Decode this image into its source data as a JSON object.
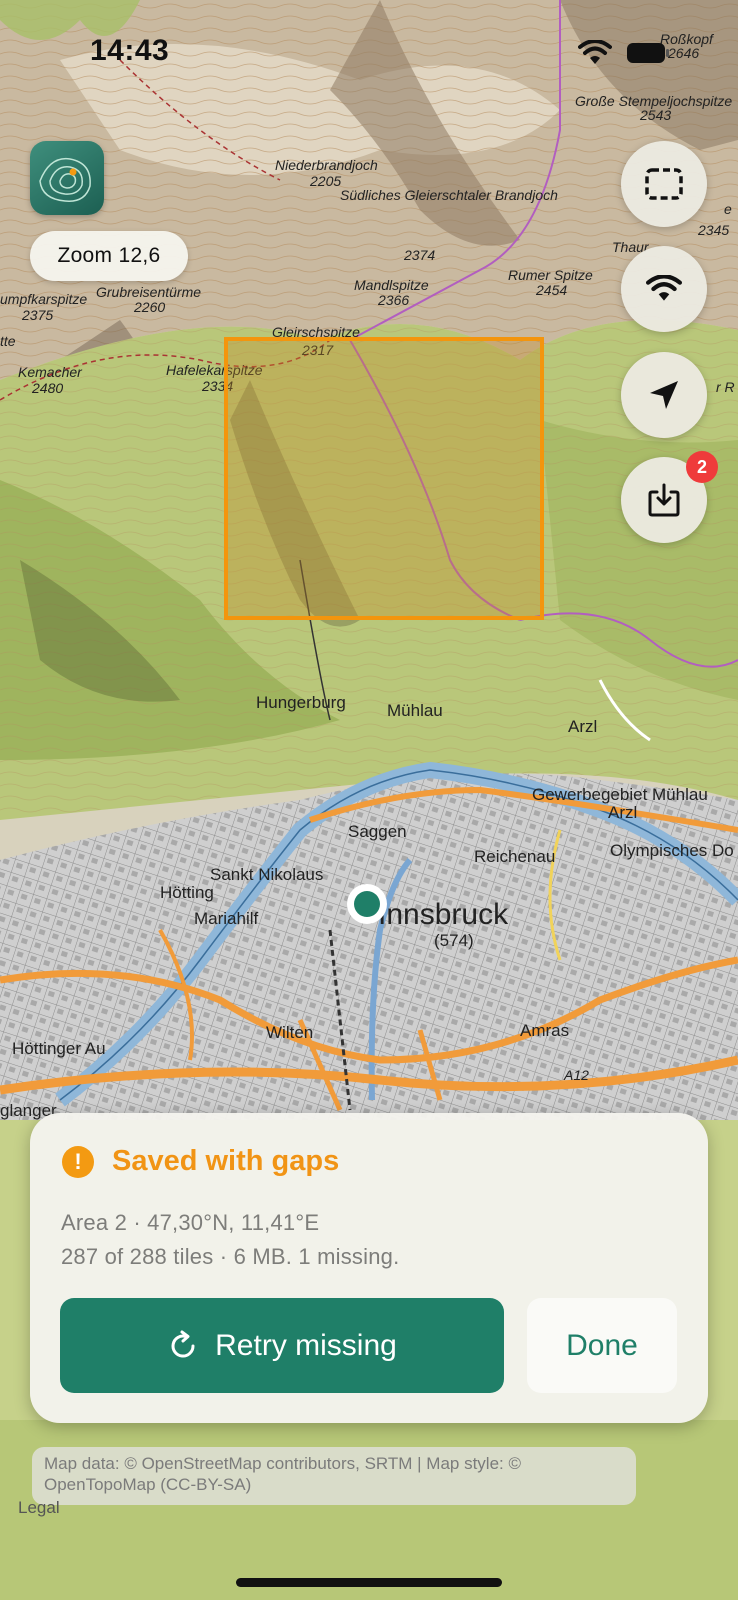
{
  "status_bar": {
    "time": "14:43"
  },
  "map": {
    "zoom_label": "Zoom 12,6",
    "peaks": [
      {
        "name": "Roßkopf",
        "elevation": "2646"
      },
      {
        "name": "Große Stempeljochspitze",
        "elevation": "2543"
      },
      {
        "name": "Niederbrandjoch",
        "elevation": "2205"
      },
      {
        "name": "Südliches Gleierschtaler Brandjoch",
        "elevation": "2374"
      },
      {
        "name": "Mandlspitze",
        "elevation": "2366"
      },
      {
        "name": "Rumer Spitze",
        "elevation": "2454"
      },
      {
        "name": "Grubreisentürme",
        "elevation": "2260"
      },
      {
        "name": "umpfkarspitze",
        "elevation": "2375"
      },
      {
        "name": "Gleirschspitze",
        "elevation": "2317"
      },
      {
        "name": "Hafelekarspitze",
        "elevation": "2334"
      },
      {
        "name": "Kemacher",
        "elevation": "2480"
      },
      {
        "name": "Thaur",
        "elevation": "2345"
      }
    ],
    "places": {
      "hungerburg": "Hungerburg",
      "muehlau": "Mühlau",
      "arzl": "Arzl",
      "gewerbegebiet": "Gewerbegebiet Mühlau",
      "arzl_small": "Arzl",
      "olympisches_dorf": "Olympisches Do",
      "saggen": "Saggen",
      "reichenau": "Reichenau",
      "sankt_nikolaus": "Sankt Nikolaus",
      "hoetting": "Hötting",
      "mariahilf": "Mariahilf",
      "innsbruck": "Innsbruck",
      "innsbruck_elev": "(574)",
      "wilten": "Wilten",
      "amras": "Amras",
      "hoettinger_au": "Höttinger Au",
      "glanger": "glanger",
      "a12": "A12",
      "r_right": "r R",
      "tte": "tte",
      "e_right": "e"
    }
  },
  "buttons": {
    "download_badge": "2"
  },
  "sheet": {
    "title": "Saved with gaps",
    "line1": "Area 2 · 47,30°N, 11,41°E",
    "line2": "287 of 288 tiles · 6 MB. 1 missing.",
    "retry_label": "Retry missing",
    "done_label": "Done"
  },
  "attribution": {
    "text": "Map data: © OpenStreetMap contributors, SRTM | Map style: © OpenTopoMap (CC-BY-SA)",
    "legal": "Legal"
  },
  "colors": {
    "accent": "#1f7f68",
    "warning": "#f19415",
    "selection": "#f3950d",
    "badge": "#ef3b3b"
  }
}
